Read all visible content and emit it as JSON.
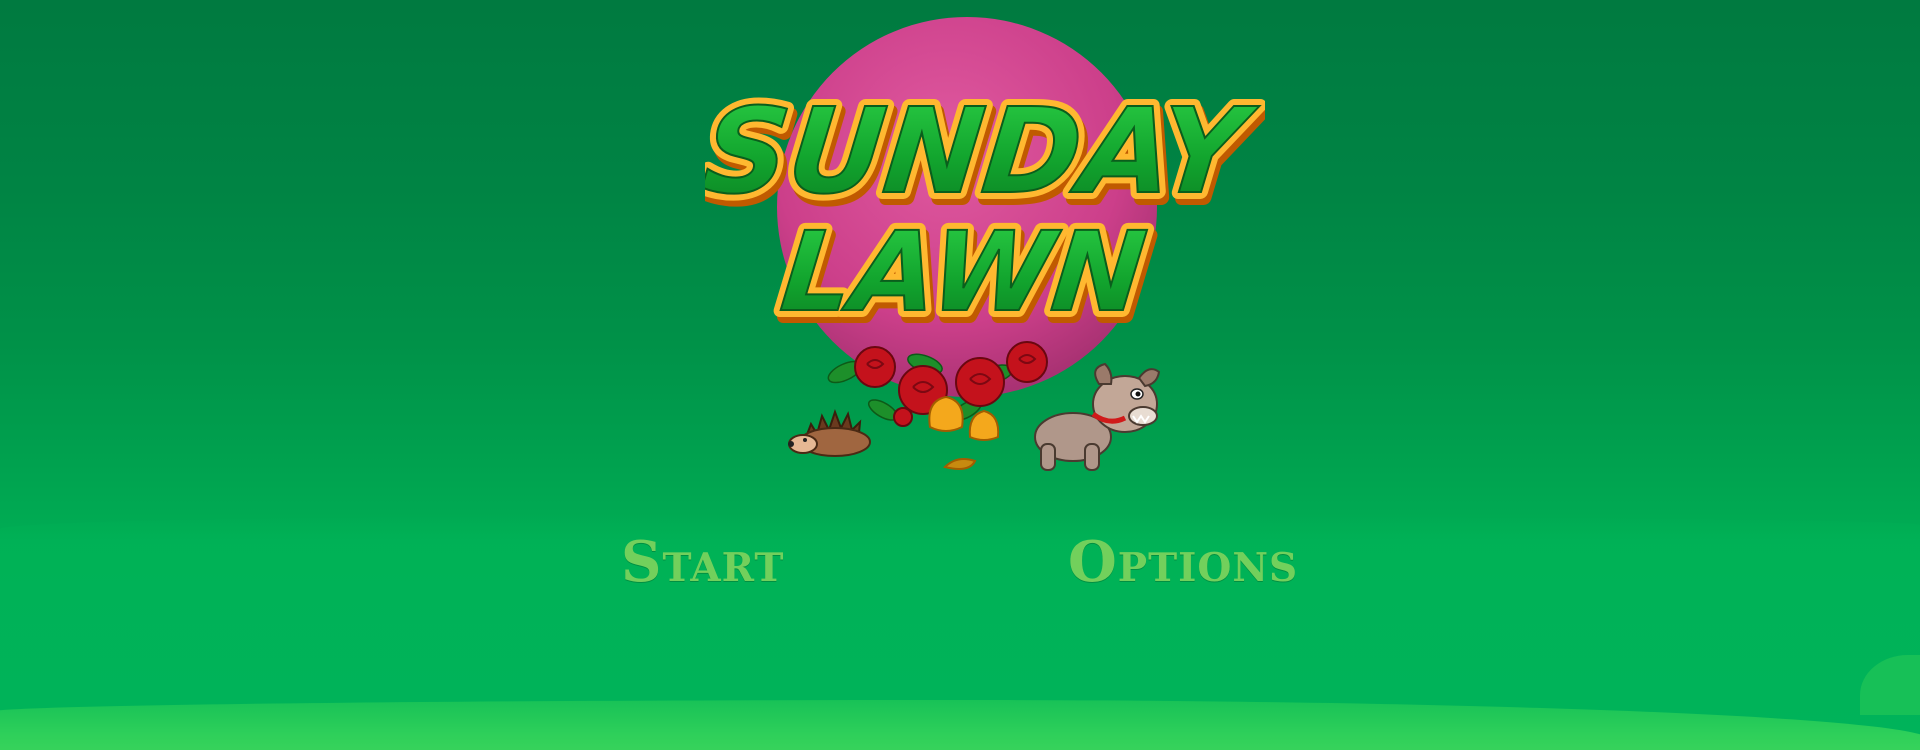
{
  "logo": {
    "line1": "SUNDAY",
    "line2": "LAWN",
    "circle_color": "#d0458f",
    "letter_fill": "#12a52e",
    "letter_outline": "#ffa318"
  },
  "menu": {
    "start_label": "Start",
    "options_label": "Options"
  },
  "colors": {
    "background_top": "#007a40",
    "background_bottom": "#00b75a",
    "menu_text": "#72d05c"
  },
  "icons": [
    "hedgehog-icon",
    "roses-icon",
    "tulips-icon",
    "bulldog-icon"
  ]
}
